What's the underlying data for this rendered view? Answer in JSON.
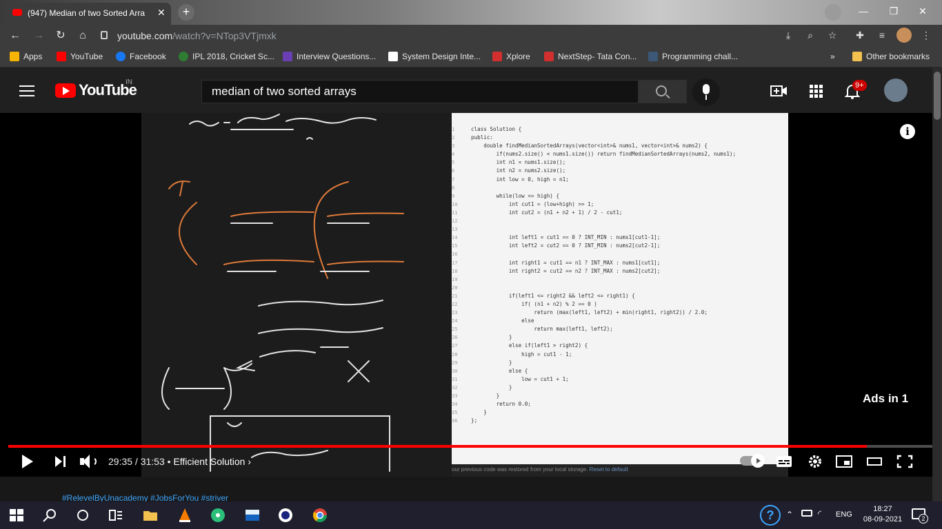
{
  "browser": {
    "tab_title": "(947) Median of two Sorted Arra",
    "tab_close": "✕",
    "new_tab": "+",
    "url_host": "youtube.com",
    "url_path": "/watch?v=NTop3VTjmxk",
    "window_controls": [
      "—",
      "❐",
      "✕"
    ]
  },
  "bookmarks": [
    {
      "label": "Apps",
      "icon": "apps-grid-icon",
      "color": "#f4b400"
    },
    {
      "label": "YouTube",
      "icon": "youtube-icon",
      "color": "#ff0000"
    },
    {
      "label": "Facebook",
      "icon": "facebook-icon",
      "color": "#1877f2"
    },
    {
      "label": "IPL 2018, Cricket Sc...",
      "icon": "cricbuzz-icon",
      "color": "#2e7d32"
    },
    {
      "label": "Interview Questions...",
      "icon": "interview-icon",
      "color": "#6a3fb4"
    },
    {
      "label": "System Design Inte...",
      "icon": "system-design-icon",
      "color": "#ffffff"
    },
    {
      "label": "Xplore",
      "icon": "tcs-icon",
      "color": "#d32f2f"
    },
    {
      "label": "NextStep- Tata Con...",
      "icon": "tcs-icon",
      "color": "#d32f2f"
    },
    {
      "label": "Programming chall...",
      "icon": "hackerrank-icon",
      "color": "#3b5877"
    }
  ],
  "bookmarks_overflow": "»",
  "other_bookmarks": "Other bookmarks",
  "youtube": {
    "logo_text": "YouTube",
    "country": "IN",
    "search_query": "median of two sorted arrays",
    "notification_count": "9+"
  },
  "player": {
    "current_time": "29:35",
    "duration": "31:53",
    "time_display": "29:35 / 31:53",
    "separator": "•",
    "chapter": "Efficient Solution",
    "chapter_arrow": "›",
    "progress_fraction": 0.928,
    "ads_text": "Ads in 1",
    "info": "i"
  },
  "editor": {
    "line_numbers": [
      "1",
      "2",
      "3",
      "4",
      "5",
      "6",
      "7",
      "8",
      "9",
      "10",
      "11",
      "12",
      "13",
      "14",
      "15",
      "16",
      "17",
      "18",
      "19",
      "20",
      "21",
      "22",
      "23",
      "24",
      "25",
      "26",
      "27",
      "28",
      "29",
      "30",
      "31",
      "32",
      "33",
      "34",
      "35",
      "36"
    ],
    "code_lines": [
      "class Solution {",
      "public:",
      "    double findMedianSortedArrays(vector<int>& nums1, vector<int>& nums2) {",
      "        if(nums2.size() < nums1.size()) return findMedianSortedArrays(nums2, nums1);",
      "        int n1 = nums1.size();",
      "        int n2 = nums2.size();",
      "        int low = 0, high = n1;",
      "",
      "        while(low <= high) {",
      "            int cut1 = (low+high) >> 1;",
      "            int cut2 = (n1 + n2 + 1) / 2 - cut1;",
      "",
      "",
      "            int left1 = cut1 == 0 ? INT_MIN : nums1[cut1-1];",
      "            int left2 = cut2 == 0 ? INT_MIN : nums2[cut2-1];",
      "",
      "            int right1 = cut1 == n1 ? INT_MAX : nums1[cut1];",
      "            int right2 = cut2 == n2 ? INT_MAX : nums2[cut2];",
      "",
      "",
      "            if(left1 <= right2 && left2 <= right1) {",
      "                if( (n1 + n2) % 2 == 0 )",
      "                    return (max(left1, left2) + min(right1, right2)) / 2.0;",
      "                else",
      "                    return max(left1, left2);",
      "            }",
      "            else if(left1 > right2) {",
      "                high = cut1 - 1;",
      "            }",
      "            else {",
      "                low = cut1 + 1;",
      "            }",
      "        }",
      "        return 0.0;",
      "    }",
      "};"
    ],
    "footer_message": "our previous code was restored from your local storage.",
    "footer_link": "Reset to default"
  },
  "below_player": {
    "hashtags": "#RelevelByUnacademy #JobsForYou #striver"
  },
  "taskbar": {
    "language": "ENG",
    "time": "18:27",
    "date": "08-09-2021",
    "notification_count": "2"
  }
}
